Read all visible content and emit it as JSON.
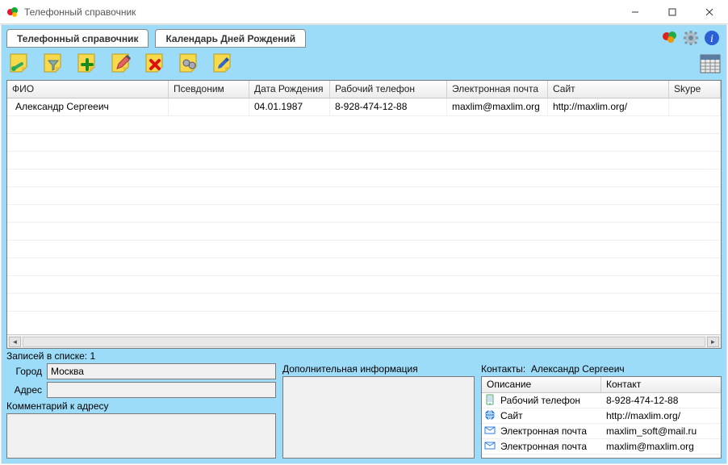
{
  "window": {
    "title": "Телефонный справочник"
  },
  "tabs": {
    "phonebook": "Телефонный справочник",
    "calendar": "Календарь Дней Рождений"
  },
  "columns": {
    "fio": "ФИО",
    "alias": "Псевдоним",
    "dob": "Дата Рождения",
    "workphone": "Рабочий телефон",
    "email": "Электронная почта",
    "site": "Сайт",
    "skype": "Skype"
  },
  "rows": [
    {
      "fio": "Александр Сергееич",
      "alias": "",
      "dob": "04.01.1987",
      "workphone": "8-928-474-12-88",
      "email": "maxlim@maxlim.org",
      "site": "http://maxlim.org/",
      "skype": ""
    }
  ],
  "status": {
    "count_label": "Записей в списке: 1"
  },
  "address": {
    "city_label": "Город",
    "city_value": "Москва",
    "addr_label": "Адрес",
    "addr_value": "",
    "comment_label": "Комментарий к адресу"
  },
  "extra": {
    "caption": "Дополнительная информация"
  },
  "contacts": {
    "caption_prefix": "Контакты:",
    "person": "Александр Сергееич",
    "col_desc": "Описание",
    "col_contact": "Контакт",
    "items": [
      {
        "icon": "phone",
        "desc": "Рабочий телефон",
        "val": "8-928-474-12-88"
      },
      {
        "icon": "globe",
        "desc": "Сайт",
        "val": "http://maxlim.org/"
      },
      {
        "icon": "mail",
        "desc": "Электронная почта",
        "val": "maxlim_soft@mail.ru"
      },
      {
        "icon": "mail",
        "desc": "Электронная почта",
        "val": "maxlim@maxlim.org"
      }
    ]
  }
}
